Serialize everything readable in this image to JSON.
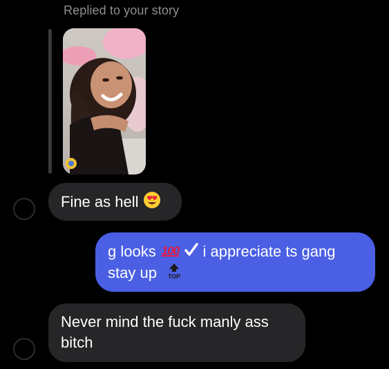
{
  "reply_context": {
    "label": "Replied to your story"
  },
  "messages": [
    {
      "side": "received",
      "text": "Fine as hell",
      "emoji": "smiling-face-with-heart-eyes-emoji"
    },
    {
      "side": "sent",
      "line1_part1": "g looks",
      "hundred_label": "100",
      "check_icon": "heavy-check-mark-emoji",
      "line1_part2": "i appreciate ts gang",
      "line2": "stay up",
      "top_icon": "top-arrow-emoji",
      "top_label": "TOP"
    },
    {
      "side": "received",
      "text": "Never mind the fuck manly ass bitch"
    }
  ],
  "colors": {
    "background": "#000000",
    "received_bubble": "#262628",
    "sent_bubble": "#4a5fe4",
    "secondary_text": "#8e8e93",
    "text": "#ffffff"
  }
}
